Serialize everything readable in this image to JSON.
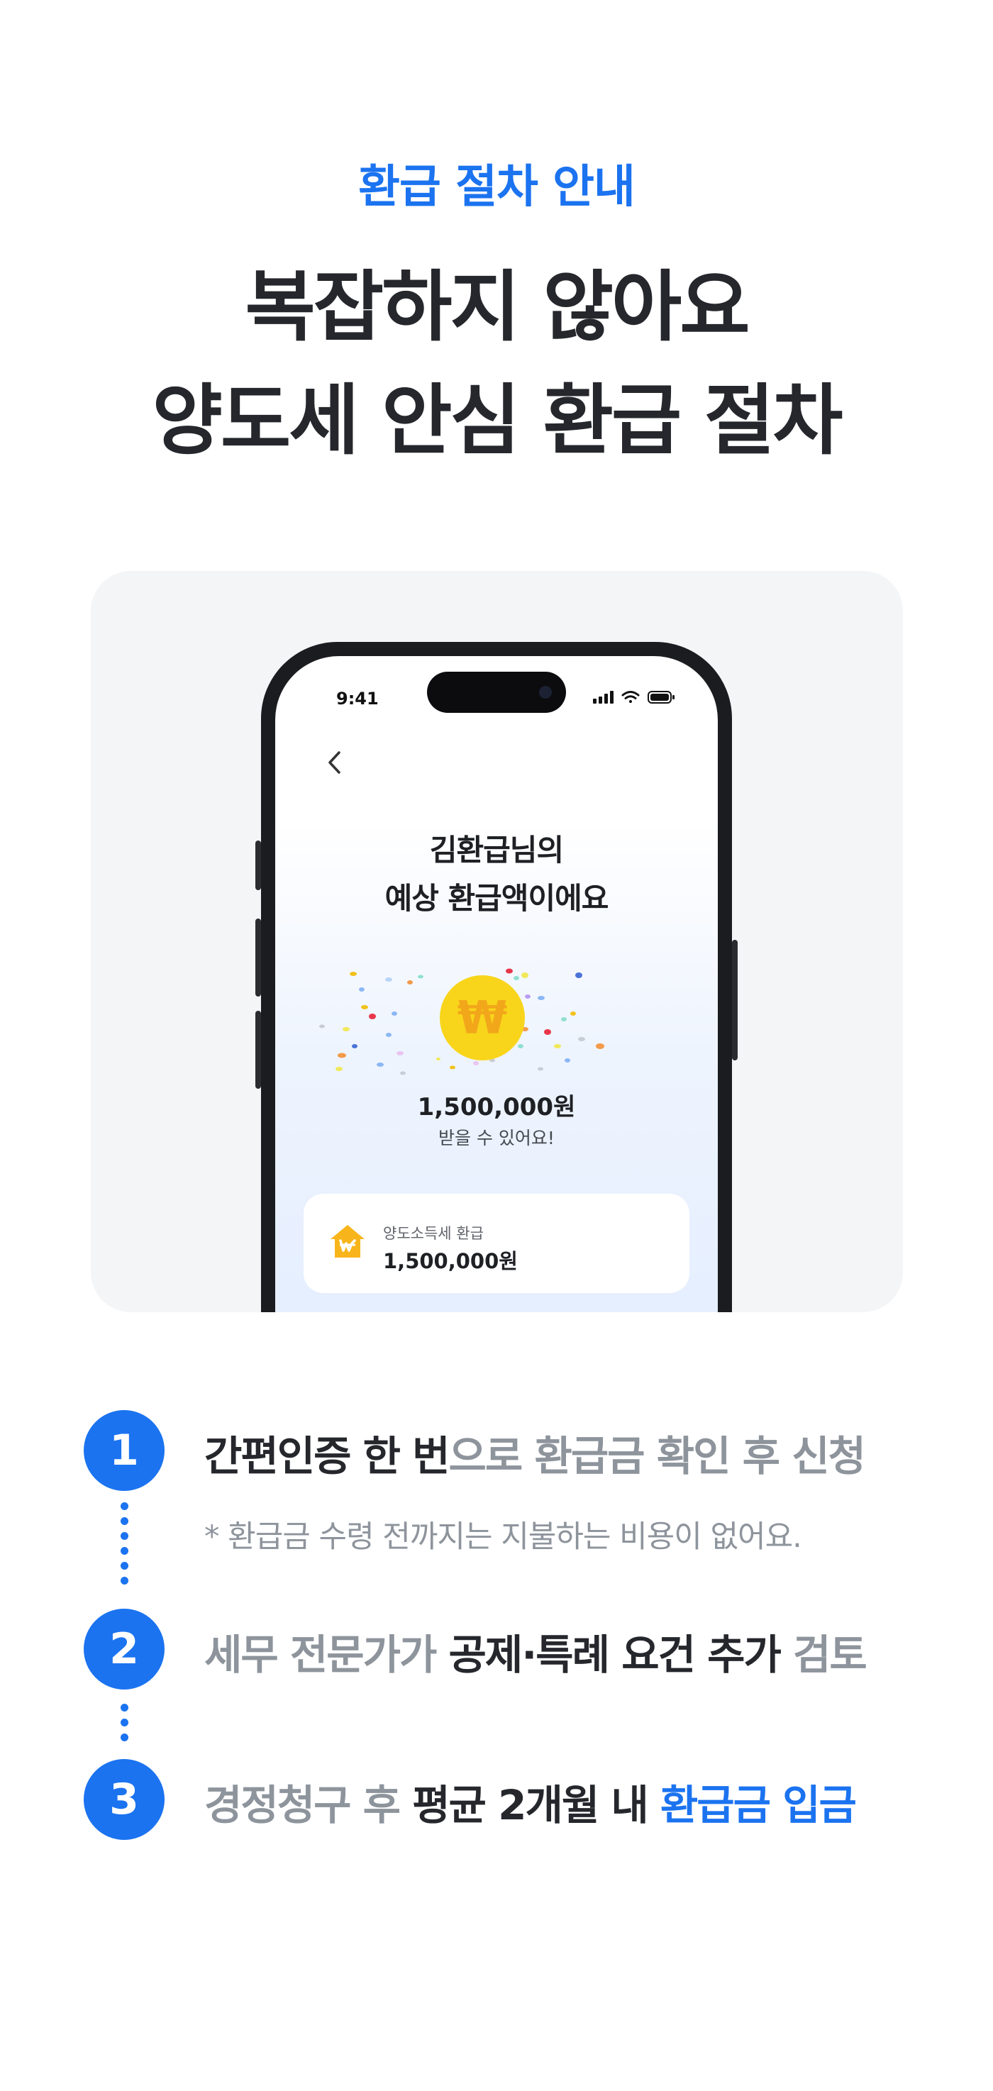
{
  "header": {
    "eyebrow": "환급 절차 안내",
    "headline_line1": "복잡하지 않아요",
    "headline_line2": "양도세 안심 환급 절차"
  },
  "phone": {
    "status_time": "9:41",
    "title_line1": "김환급님의",
    "title_line2": "예상 환급액이에요",
    "coin_symbol": "₩",
    "amount": "1,500,000원",
    "amount_sub": "받을 수 있어요!",
    "card": {
      "label": "양도소득세 환급",
      "value": "1,500,000원"
    }
  },
  "steps": [
    {
      "number": "1",
      "parts": [
        {
          "text": "간편인증 한 번",
          "tone": "dark"
        },
        {
          "text": "으로 환급금 확인 후 신청",
          "tone": "gray"
        }
      ],
      "note": "* 환급금 수령 전까지는 지불하는 비용이 없어요."
    },
    {
      "number": "2",
      "parts": [
        {
          "text": "세무 전문가가 ",
          "tone": "gray"
        },
        {
          "text": "공제·특례 요건 추가",
          "tone": "dark"
        },
        {
          "text": " 검토",
          "tone": "gray"
        }
      ]
    },
    {
      "number": "3",
      "parts": [
        {
          "text": "경정청구 후 ",
          "tone": "gray"
        },
        {
          "text": "평균 2개월 내 ",
          "tone": "dark"
        },
        {
          "text": "환급금 입금",
          "tone": "blue"
        }
      ]
    }
  ],
  "colors": {
    "accent": "#1b73f0",
    "text_dark": "#25272c",
    "text_gray": "#8e949c",
    "panel_bg": "#f4f5f7",
    "coin": "#f8d51b"
  }
}
